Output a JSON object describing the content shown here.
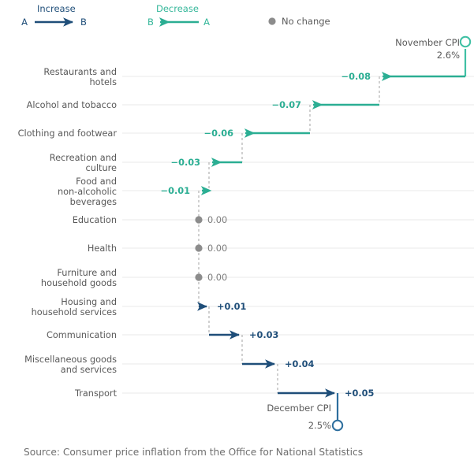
{
  "legend": {
    "increase": {
      "title": "Increase",
      "from": "A",
      "to": "B",
      "color": "#1f4e79"
    },
    "decrease": {
      "title": "Decrease",
      "from": "A",
      "to": "B",
      "color": "#2bae93"
    },
    "no_change": {
      "label": "No change",
      "color": "#8c8c8c"
    }
  },
  "endpoints": {
    "start": {
      "name": "November CPI",
      "value": "2.6%"
    },
    "end": {
      "name": "December CPI",
      "value": "2.5%"
    }
  },
  "source": "Source: Consumer price inflation from the Office for National Statistics",
  "chart_data": {
    "type": "bar",
    "chart_subtype": "waterfall",
    "title": "",
    "subtitle": "",
    "xlabel": "",
    "ylabel": "",
    "grid": true,
    "legend_position": "top",
    "start_label": "November CPI",
    "start_value": 2.6,
    "start_value_text": "2.6%",
    "end_label": "December CPI",
    "end_value": 2.5,
    "end_value_text": "2.5%",
    "units": "percentage points",
    "categories": [
      "Restaurants and hotels",
      "Alcohol and tobacco",
      "Clothing and footwear",
      "Recreation and culture",
      "Food and non-alcoholic beverages",
      "Education",
      "Health",
      "Furniture and household goods",
      "Housing and household services",
      "Communication",
      "Miscellaneous goods and services",
      "Transport"
    ],
    "values": [
      -0.08,
      -0.07,
      -0.06,
      -0.03,
      -0.01,
      0.0,
      0.0,
      0.0,
      0.01,
      0.03,
      0.04,
      0.05
    ],
    "value_labels": [
      "−0.08",
      "−0.07",
      "−0.06",
      "−0.03",
      "−0.01",
      "0.00",
      "0.00",
      "0.00",
      "+0.01",
      "+0.03",
      "+0.04",
      "+0.05"
    ],
    "directions": [
      "decrease",
      "decrease",
      "decrease",
      "decrease",
      "decrease",
      "none",
      "none",
      "none",
      "increase",
      "increase",
      "increase",
      "increase"
    ],
    "colors": {
      "increase": "#1f4e79",
      "decrease": "#2bae93",
      "no_change": "#8c8c8c"
    }
  },
  "rows": [
    {
      "label_line1": "Restaurants and",
      "label_line2": "hotels",
      "value": "−0.08",
      "dir": "decrease"
    },
    {
      "label_line1": "Alcohol and tobacco",
      "label_line2": "",
      "value": "−0.07",
      "dir": "decrease"
    },
    {
      "label_line1": "Clothing and footwear",
      "label_line2": "",
      "value": "−0.06",
      "dir": "decrease"
    },
    {
      "label_line1": "Recreation and",
      "label_line2": "culture",
      "value": "−0.03",
      "dir": "decrease"
    },
    {
      "label_line1": "Food and",
      "label_line2": "non-alcoholic",
      "label_line3": "beverages",
      "value": "−0.01",
      "dir": "decrease"
    },
    {
      "label_line1": "Education",
      "label_line2": "",
      "value": "0.00",
      "dir": "none"
    },
    {
      "label_line1": "Health",
      "label_line2": "",
      "value": "0.00",
      "dir": "none"
    },
    {
      "label_line1": "Furniture and",
      "label_line2": "household goods",
      "value": "0.00",
      "dir": "none"
    },
    {
      "label_line1": "Housing and",
      "label_line2": "household services",
      "value": "+0.01",
      "dir": "increase"
    },
    {
      "label_line1": "Communication",
      "label_line2": "",
      "value": "+0.03",
      "dir": "increase"
    },
    {
      "label_line1": "Miscellaneous goods",
      "label_line2": "and services",
      "value": "+0.04",
      "dir": "increase"
    },
    {
      "label_line1": "Transport",
      "label_line2": "",
      "value": "+0.05",
      "dir": "increase"
    }
  ]
}
